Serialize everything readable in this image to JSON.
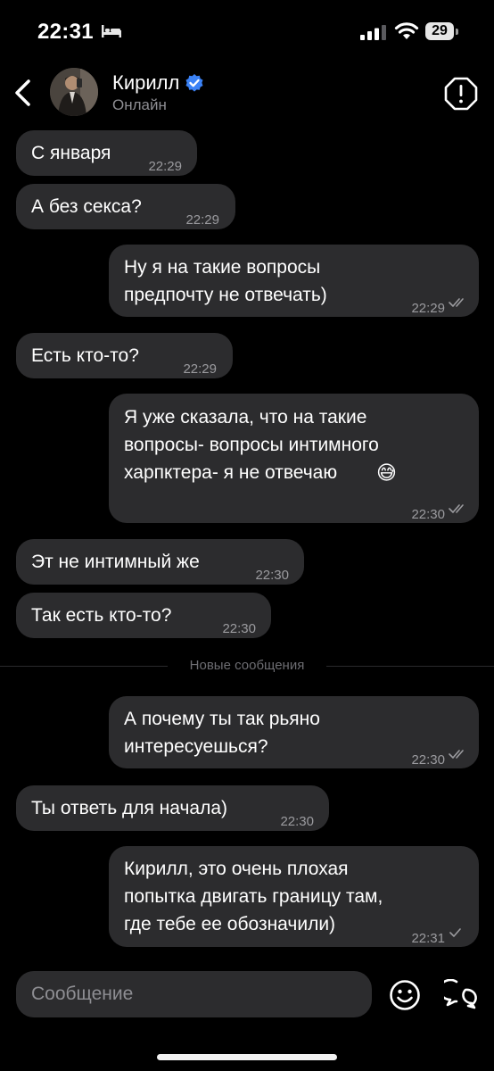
{
  "status_bar": {
    "time": "22:31",
    "battery": "29",
    "icons": [
      "bed-icon",
      "signal-icon",
      "wifi-icon",
      "battery-icon"
    ]
  },
  "header": {
    "name": "Кирилл",
    "status": "Онлайн",
    "verified": true,
    "icons": [
      "back-arrow-icon",
      "verified-badge-icon",
      "report-icon"
    ]
  },
  "messages": [
    {
      "direction": "in",
      "text": "С января",
      "time": "22:29"
    },
    {
      "direction": "in",
      "text": "А без секса?",
      "time": "22:29"
    },
    {
      "direction": "out",
      "text": "Ну я на такие вопросы\nпредпочту не отвечать)",
      "time": "22:29",
      "read": true
    },
    {
      "direction": "in",
      "text": "Есть кто-то?",
      "time": "22:29"
    },
    {
      "direction": "out",
      "text": "Я уже сказала, что на такие\nвопросы- вопросы интимного\nхарпктера- я не отвечаю",
      "emoji": "😅",
      "time": "22:30",
      "read": true
    },
    {
      "direction": "in",
      "text": "Эт не интимный же",
      "time": "22:30"
    },
    {
      "direction": "in",
      "text": "Так есть кто-то?",
      "time": "22:30"
    },
    {
      "direction": "out",
      "text": "А почему ты так рьяно\nинтересуешься?",
      "time": "22:30",
      "read": true
    },
    {
      "direction": "in",
      "text": "Ты ответь для начала)",
      "time": "22:30"
    },
    {
      "direction": "out",
      "text": "Кирилл, это очень плохая\nпопытка двигать границу там,\nгде тебе ее обозначили)",
      "time": "22:31",
      "read": false
    }
  ],
  "divider": {
    "label": "Новые сообщения"
  },
  "composer": {
    "placeholder": "Сообщение",
    "icons": [
      "emoji-icon",
      "chat-bubbles-icon"
    ]
  },
  "colors": {
    "background": "#000000",
    "bubble": "#2c2c2e",
    "accent_verified": "#3b82f6",
    "timestamp": "#9b9b9f"
  }
}
